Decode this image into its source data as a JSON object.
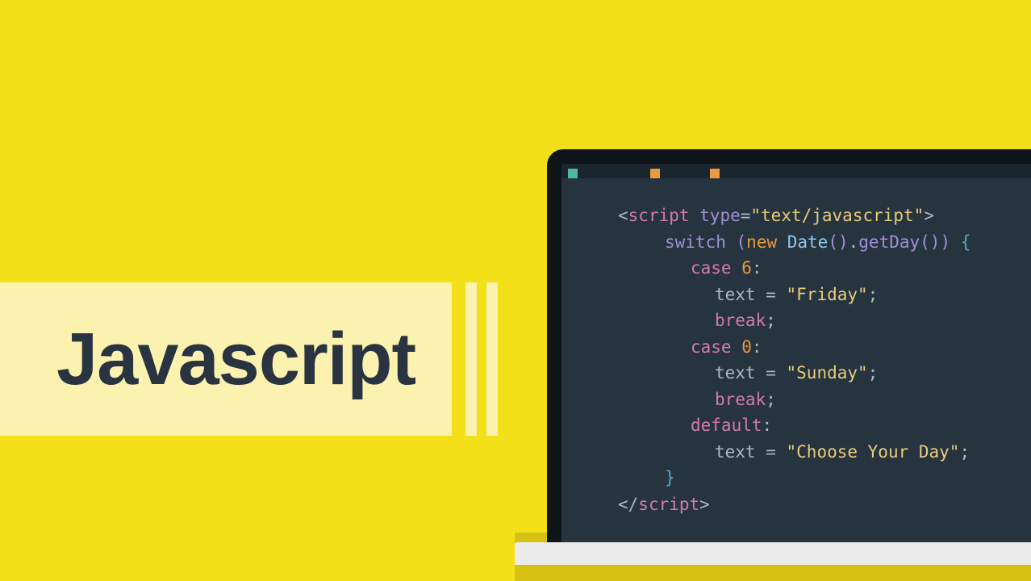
{
  "title": "Javascript",
  "code": {
    "script_open_lt": "<",
    "script_tag": "script",
    "script_attr": " type",
    "script_eq": "=",
    "script_attr_val": "\"text/javascript\"",
    "script_open_gt": ">",
    "switch_kw": "switch ",
    "paren_open": "(",
    "new_kw": "new ",
    "date_class": "Date",
    "date_parens": "()",
    "dot": ".",
    "getday": "getDay",
    "getday_parens": "()",
    "paren_close": ")",
    "brace_open": " {",
    "case1_kw": "case ",
    "case1_num": "6",
    "case1_colon": ":",
    "text_var1": "text ",
    "op_eq1": "= ",
    "friday": "\"Friday\"",
    "semi1": ";",
    "break1": "break",
    "semi2": ";",
    "case2_kw": "case ",
    "case2_num": "0",
    "case2_colon": ":",
    "text_var2": "text ",
    "op_eq2": "= ",
    "sunday": "\"Sunday\"",
    "semi3": ";",
    "break2": "break",
    "semi4": ";",
    "default_kw": "default",
    "default_colon": ":",
    "text_var3": "text ",
    "op_eq3": "= ",
    "choose": "\"Choose Your Day\"",
    "semi5": ";",
    "brace_close": "}",
    "script_close_lt": "</",
    "script_close_tag": "script",
    "script_close_gt": ">"
  }
}
